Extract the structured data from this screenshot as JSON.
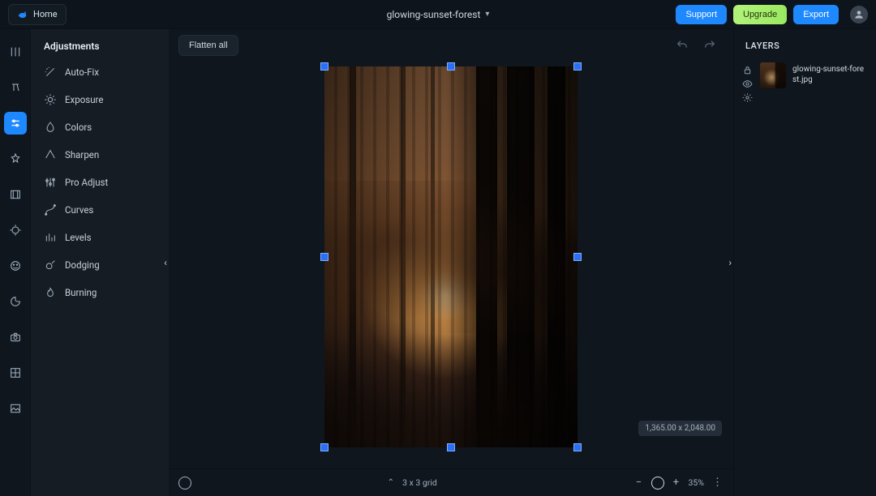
{
  "header": {
    "home": "Home",
    "title": "glowing-sunset-forest",
    "support": "Support",
    "upgrade": "Upgrade",
    "export": "Export"
  },
  "adjustments": {
    "title": "Adjustments",
    "items": [
      {
        "key": "autofix",
        "label": "Auto-Fix"
      },
      {
        "key": "exposure",
        "label": "Exposure"
      },
      {
        "key": "colors",
        "label": "Colors"
      },
      {
        "key": "sharpen",
        "label": "Sharpen"
      },
      {
        "key": "proadjust",
        "label": "Pro Adjust"
      },
      {
        "key": "curves",
        "label": "Curves"
      },
      {
        "key": "levels",
        "label": "Levels"
      },
      {
        "key": "dodging",
        "label": "Dodging"
      },
      {
        "key": "burning",
        "label": "Burning"
      }
    ]
  },
  "canvas": {
    "flatten": "Flatten all",
    "dimensions": "1,365.00 x 2,048.00"
  },
  "bottom": {
    "grid": "3 x 3 grid",
    "zoom": "35%"
  },
  "layers": {
    "title": "LAYERS",
    "items": [
      {
        "name": "glowing-sunset-forest.jpg"
      }
    ]
  }
}
